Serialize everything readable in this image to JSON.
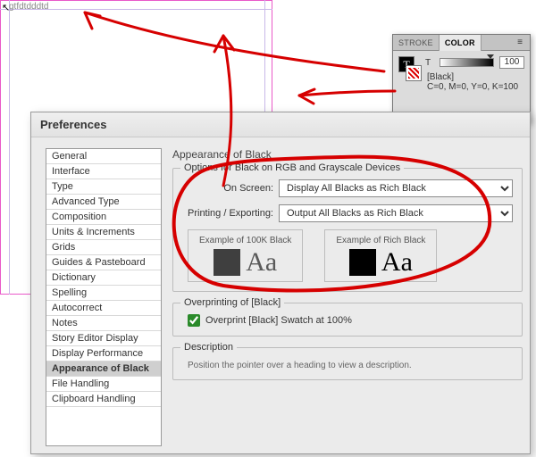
{
  "doc": {
    "sample_text": "gtfdtdddtd"
  },
  "color_panel": {
    "tabs": [
      "STROKE",
      "COLOR"
    ],
    "active_tab": "COLOR",
    "tint_letter": "T",
    "tint_value": "100",
    "swatch_name": "[Black]",
    "breakdown": "C=0, M=0, Y=0, K=100"
  },
  "dialog": {
    "title": "Preferences",
    "categories": [
      "General",
      "Interface",
      "Type",
      "Advanced Type",
      "Composition",
      "Units & Increments",
      "Grids",
      "Guides & Pasteboard",
      "Dictionary",
      "Spelling",
      "Autocorrect",
      "Notes",
      "Story Editor Display",
      "Display Performance",
      "Appearance of Black",
      "File Handling",
      "Clipboard Handling"
    ],
    "selected_category": "Appearance of Black",
    "panel_title": "Appearance of Black",
    "group1_legend": "Options for Black on RGB and Grayscale Devices",
    "onscreen_label": "On Screen:",
    "onscreen_value": "Display All Blacks as Rich Black",
    "printing_label": "Printing / Exporting:",
    "printing_value": "Output All Blacks as Rich Black",
    "ex100_label": "Example of 100K Black",
    "exrich_label": "Example of Rich Black",
    "aa_sample": "Aa",
    "group2_legend": "Overprinting of [Black]",
    "overprint_checkbox": "Overprint [Black] Swatch at 100%",
    "desc_legend": "Description",
    "desc_text": "Position the pointer over a heading to view a description."
  }
}
